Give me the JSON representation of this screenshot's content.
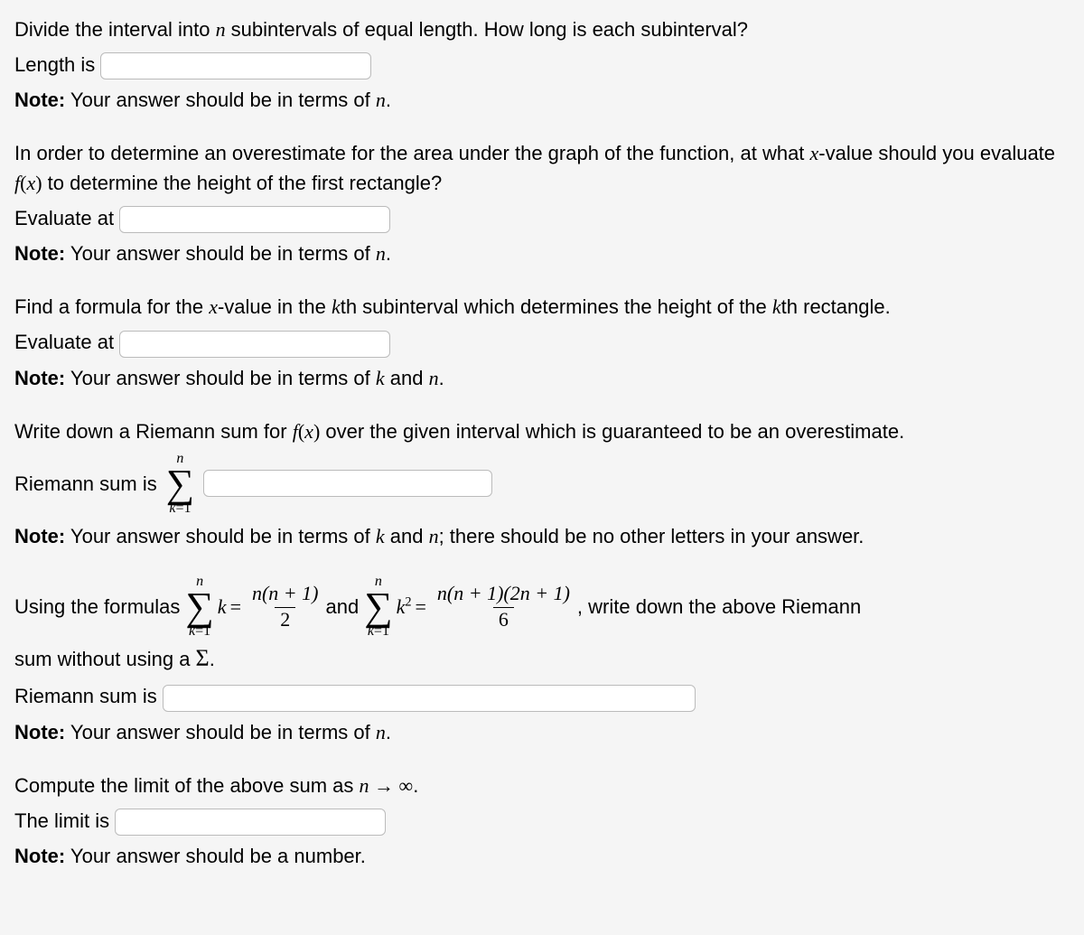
{
  "q1": {
    "prompt_a": "Divide the interval into ",
    "var": "n",
    "prompt_b": " subintervals of equal length. How long is each subinterval?",
    "label": "Length is",
    "note_a": "Note:",
    "note_b": " Your answer should be in terms of ",
    "note_var": "n",
    "note_c": "."
  },
  "q2": {
    "prompt_a": "In order to determine an overestimate for the area under the graph of the function, at what ",
    "var_x": "x",
    "prompt_b": "-value should you evaluate ",
    "fx": "f(x)",
    "prompt_c": " to determine the height of the first rectangle?",
    "label": "Evaluate at",
    "note_a": "Note:",
    "note_b": " Your answer should be in terms of ",
    "note_var": "n",
    "note_c": "."
  },
  "q3": {
    "prompt_a": "Find a formula for the ",
    "var_x": "x",
    "prompt_b": "-value in the ",
    "var_k": "k",
    "prompt_c": "th subinterval which determines the height of the ",
    "var_k2": "k",
    "prompt_d": "th rectangle.",
    "label": "Evaluate at",
    "note_a": "Note:",
    "note_b": " Your answer should be in terms of ",
    "note_var1": "k",
    "note_and": " and ",
    "note_var2": "n",
    "note_c": "."
  },
  "q4": {
    "prompt_a": "Write down a Riemann sum for ",
    "fx": "f(x)",
    "prompt_b": " over the given interval which is guaranteed to be an overestimate.",
    "label": "Riemann sum is",
    "sigma_top": "n",
    "sigma_bot_k": "k",
    "sigma_bot_eq": "=1",
    "note_a": "Note:",
    "note_b": " Your answer should be in terms of ",
    "note_var1": "k",
    "note_and": " and ",
    "note_var2": "n",
    "note_c": "; there should be no other letters in your answer."
  },
  "q5": {
    "prompt_a": "Using the formulas ",
    "sig1_top": "n",
    "sig1_bot_k": "k",
    "sig1_bot_eq": "=1",
    "sig1_term": "k",
    "eq": " = ",
    "frac1_num": "n(n + 1)",
    "frac1_den": "2",
    "and": " and ",
    "sig2_top": "n",
    "sig2_bot_k": "k",
    "sig2_bot_eq": "=1",
    "sig2_term_base": "k",
    "sig2_term_exp": "2",
    "frac2_num": "n(n + 1)(2n + 1)",
    "frac2_den": "6",
    "prompt_b": ", write down the above Riemann",
    "prompt_c": "sum without using a ",
    "sigma_sym": "Σ",
    "prompt_d": ".",
    "label": "Riemann sum is",
    "note_a": "Note:",
    "note_b": " Your answer should be in terms of ",
    "note_var": "n",
    "note_c": "."
  },
  "q6": {
    "prompt_a": "Compute the limit of the above sum as ",
    "limit_expr_n": "n",
    "limit_arrow": " → ∞",
    "prompt_b": ".",
    "label": "The limit is",
    "note_a": "Note:",
    "note_b": " Your answer should be a number."
  }
}
